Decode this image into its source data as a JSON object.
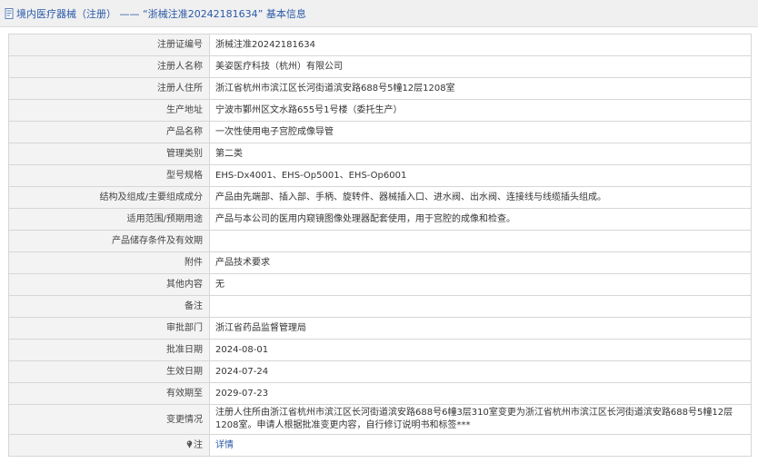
{
  "header": {
    "title": "境内医疗器械（注册） —— “浙械注准20242181634” 基本信息",
    "icon": "document-icon"
  },
  "rows": [
    {
      "label": "注册证编号",
      "value": "浙械注准20242181634"
    },
    {
      "label": "注册人名称",
      "value": "美姿医疗科技（杭州）有限公司"
    },
    {
      "label": "注册人住所",
      "value": "浙江省杭州市滨江区长河街道滨安路688号5幢12层1208室"
    },
    {
      "label": "生产地址",
      "value": "宁波市鄞州区文水路655号1号楼（委托生产）"
    },
    {
      "label": "产品名称",
      "value": "一次性使用电子宫腔成像导管"
    },
    {
      "label": "管理类别",
      "value": "第二类"
    },
    {
      "label": "型号规格",
      "value": "EHS-Dx4001、EHS-Op5001、EHS-Op6001"
    },
    {
      "label": "结构及组成/主要组成成分",
      "value": "产品由先端部、插入部、手柄、旋转件、器械插入口、进水阀、出水阀、连接线与线缆插头组成。"
    },
    {
      "label": "适用范围/预期用途",
      "value": "产品与本公司的医用内窥镜图像处理器配套使用，用于宫腔的成像和检查。"
    },
    {
      "label": "产品储存条件及有效期",
      "value": ""
    },
    {
      "label": "附件",
      "value": "产品技术要求"
    },
    {
      "label": "其他内容",
      "value": "无"
    },
    {
      "label": "备注",
      "value": ""
    },
    {
      "label": "审批部门",
      "value": "浙江省药品监督管理局"
    },
    {
      "label": "批准日期",
      "value": "2024-08-01"
    },
    {
      "label": "生效日期",
      "value": "2024-07-24"
    },
    {
      "label": "有效期至",
      "value": "2029-07-23"
    },
    {
      "label": "变更情况",
      "value": "注册人住所由浙江省杭州市滨江区长河街道滨安路688号6幢3层310室变更为浙江省杭州市滨江区长河街道滨安路688号5幢12层1208室。申请人根据批准变更内容，自行修订说明书和标签***"
    }
  ],
  "note": {
    "label": "注",
    "icon": "pin-icon",
    "link": "详情"
  },
  "colors": {
    "accent": "#2a59a8",
    "label_bg": "#f3f3f3",
    "border": "#d6d6d6"
  }
}
